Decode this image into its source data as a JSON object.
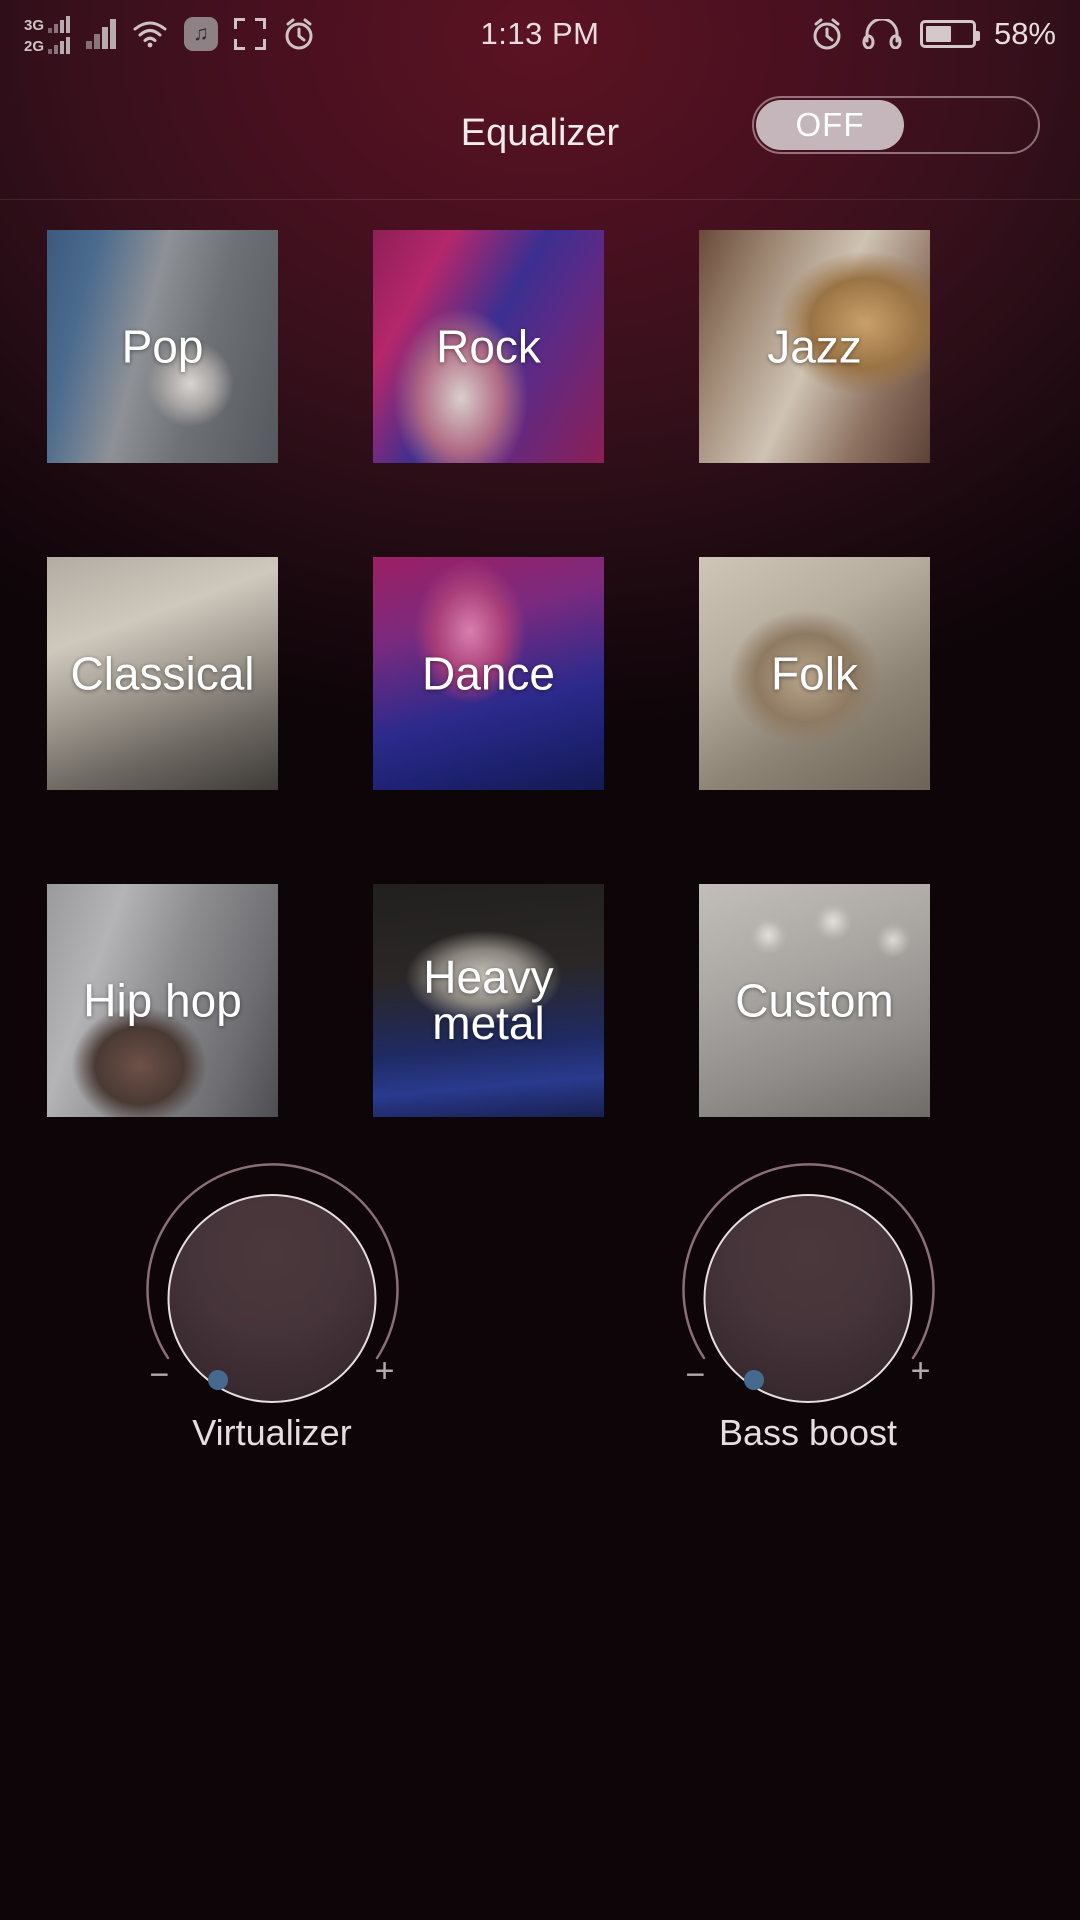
{
  "status_bar": {
    "network_3g_label": "3G",
    "network_2g_label": "2G",
    "time": "1:13 PM",
    "battery_percent": "58%",
    "battery_level": 58,
    "icons": [
      "signal-3g-icon",
      "signal-2g-icon",
      "signal-bars-icon",
      "wifi-icon",
      "music-note-icon",
      "screenshot-icon",
      "alarm-clock-icon",
      "alarm-icon",
      "headphones-icon",
      "battery-icon"
    ]
  },
  "header": {
    "title": "Equalizer",
    "toggle_state": "OFF"
  },
  "presets": [
    {
      "label": "Pop",
      "art": "art-pop",
      "name": "preset-pop"
    },
    {
      "label": "Rock",
      "art": "art-rock",
      "name": "preset-rock"
    },
    {
      "label": "Jazz",
      "art": "art-jazz",
      "name": "preset-jazz"
    },
    {
      "label": "Classical",
      "art": "art-classical",
      "name": "preset-classical"
    },
    {
      "label": "Dance",
      "art": "art-dance",
      "name": "preset-dance"
    },
    {
      "label": "Folk",
      "art": "art-folk",
      "name": "preset-folk"
    },
    {
      "label": "Hip hop",
      "art": "art-hiphop",
      "name": "preset-hip-hop"
    },
    {
      "label": "Heavy\nmetal",
      "art": "art-heavy",
      "name": "preset-heavy-metal"
    },
    {
      "label": "Custom",
      "art": "art-custom",
      "name": "preset-custom",
      "chevron": "›"
    }
  ],
  "knobs": [
    {
      "label": "Virtualizer",
      "minus": "−",
      "plus": "+"
    },
    {
      "label": "Bass boost",
      "minus": "−",
      "plus": "+"
    }
  ],
  "colors": {
    "background_top": "#5b1322",
    "background_bottom": "#0d0508",
    "text": "#f2eaec",
    "toggle_knob": "#c4b6ba",
    "knob_indicator": "#46698f",
    "knob_ring": "#e8dfe1"
  }
}
